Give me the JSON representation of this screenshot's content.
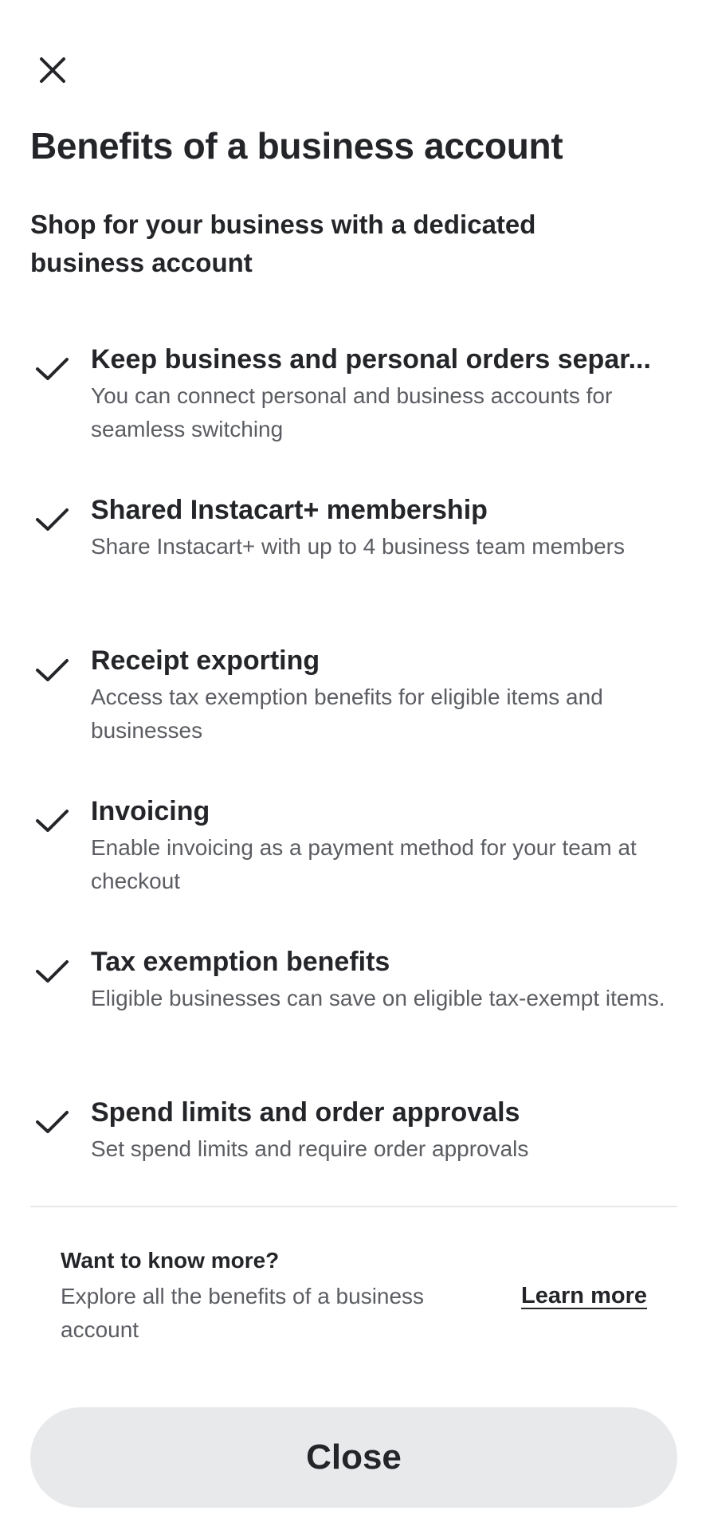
{
  "header": {
    "close_icon": "close-icon",
    "title": "Benefits of a business account",
    "subtitle": "Shop for your business with a dedicated business account"
  },
  "benefits": [
    {
      "icon": "checkmark-icon",
      "title": "Keep business and personal orders separ...",
      "description": "You can connect personal and business accounts for seamless switching"
    },
    {
      "icon": "checkmark-icon",
      "title": "Shared Instacart+ membership",
      "description": "Share Instacart+ with up to 4 business team members"
    },
    {
      "icon": "checkmark-icon",
      "title": "Receipt exporting",
      "description": "Access tax exemption benefits for eligible items and businesses"
    },
    {
      "icon": "checkmark-icon",
      "title": "Invoicing",
      "description": "Enable invoicing as a payment method for your team at checkout"
    },
    {
      "icon": "checkmark-icon",
      "title": "Tax exemption benefits",
      "description": "Eligible businesses can save on eligible tax-exempt items."
    },
    {
      "icon": "checkmark-icon",
      "title": "Spend limits and order approvals",
      "description": "Set spend limits and require order approvals"
    }
  ],
  "more_info": {
    "title": "Want to know more?",
    "description": "Explore all the benefits of a business account",
    "link_label": "Learn more"
  },
  "footer": {
    "close_label": "Close"
  },
  "colors": {
    "text_primary": "#242529",
    "text_secondary": "#5b5d62",
    "button_bg": "#e8e9eb",
    "divider": "#e8e9eb"
  }
}
